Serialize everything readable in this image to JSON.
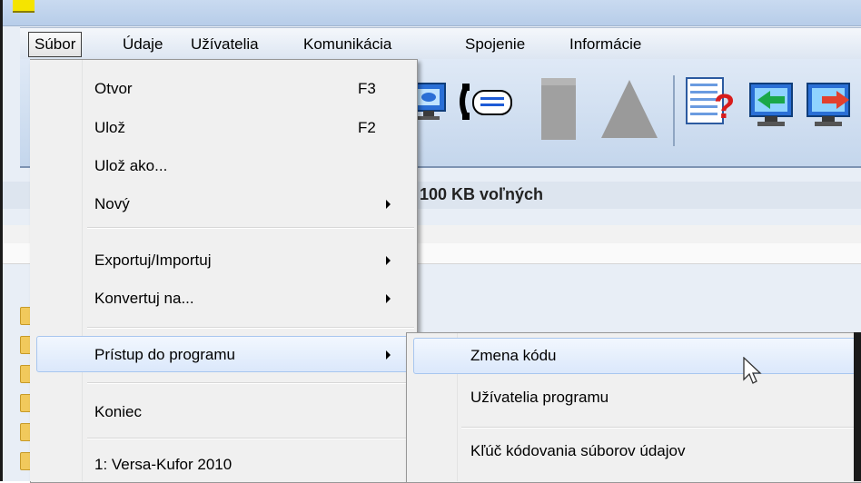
{
  "menubar": {
    "items": [
      "Súbor",
      "Údaje",
      "Užívatelia",
      "Komunikácia",
      "Spojenie",
      "Informácie"
    ]
  },
  "status": {
    "free_space_fragment": "100 KB voľných"
  },
  "file_menu": {
    "items": [
      {
        "label": "Otvor",
        "shortcut": "F3"
      },
      {
        "label": "Ulož",
        "shortcut": "F2"
      },
      {
        "label": "Ulož ako..."
      },
      {
        "label": "Nový"
      },
      {
        "label": "Exportuj/Importuj"
      },
      {
        "label": "Konvertuj na..."
      },
      {
        "label": "Prístup do programu"
      },
      {
        "label": "Koniec"
      },
      {
        "label": "1: Versa-Kufor 2010"
      }
    ]
  },
  "submenu": {
    "items": [
      {
        "label": "Zmena kódu"
      },
      {
        "label": "Užívatelia programu"
      },
      {
        "label": "Kľúč kódovania súborov údajov"
      }
    ]
  },
  "colors": {
    "menu_background": "#f0f0f0",
    "highlight": "#dbe8fb",
    "highlight_border": "#a8c6ef",
    "toolbar": "#c4d6ec"
  },
  "icons": [
    "monitor-icon",
    "phone-icon",
    "document-icon",
    "triangle-icon",
    "help-document-icon",
    "import-icon",
    "export-icon"
  ]
}
